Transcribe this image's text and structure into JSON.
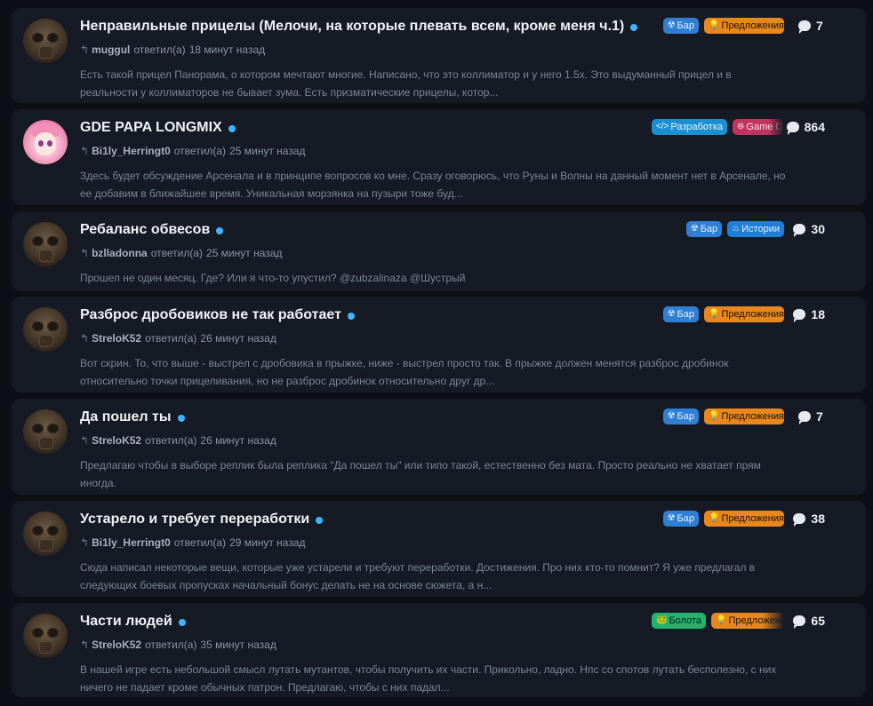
{
  "topics": [
    {
      "avatar": "gasmask-avatar",
      "title": "Неправильные прицелы (Мелочи, на которые плевать всем, кроме меня ч.1)",
      "user": "muggul",
      "answered": "ответил(а)",
      "time": "18 минут назад",
      "excerpt": "Есть такой прицел Панорама, о котором мечтают многие. Написано, что это коллиматор и у него 1.5x. Это выдуманный прицел и в реальности у коллиматоров не бывает зума. Есть призматические прицелы, котор...",
      "tags": [
        {
          "label": "Бар",
          "icon": "radiation-icon",
          "glyph": "☢",
          "style": "bar"
        },
        {
          "label": "Предложения",
          "icon": "lightbulb-icon",
          "glyph": "💡",
          "style": "pred"
        }
      ],
      "replies": "7"
    },
    {
      "avatar": "anime-avatar",
      "title": "GDE PAPA LONGMIX",
      "user": "Bi1ly_Herringt0",
      "answered": "ответил(а)",
      "time": "25 минут назад",
      "excerpt": "Здесь будет обсуждение Арсенала и в принципе вопросов ко мне. Сразу оговорюсь, что Руны и Волны на данный момент нет в Арсенале, но ее добавим в ближайшее время. Уникальная морзянка на пузыри тоже буд...",
      "tags": [
        {
          "label": "Разработка",
          "icon": "code-icon",
          "glyph": "</>",
          "style": "dev"
        },
        {
          "label": "Game D",
          "icon": "gamepad-icon",
          "glyph": "⊛",
          "style": "gd fade"
        }
      ],
      "replies": "864"
    },
    {
      "avatar": "gasmask-avatar",
      "title": "Ребаланс обвесов",
      "user": "bzlladonna",
      "answered": "ответил(а)",
      "time": "25 минут назад",
      "excerpt": "Прошел не один месяц. Где? Или я что-то упустил? @zubzalinaza @Шустрый",
      "tags": [
        {
          "label": "Бар",
          "icon": "radiation-icon",
          "glyph": "☢",
          "style": "bar"
        },
        {
          "label": "Истории",
          "icon": "flame-icon",
          "glyph": "♨",
          "style": "hist"
        }
      ],
      "replies": "30"
    },
    {
      "avatar": "gasmask-avatar",
      "title": "Разброс дробовиков не так работает",
      "user": "StreloK52",
      "answered": "ответил(а)",
      "time": "26 минут назад",
      "excerpt": "Вот скрин. То, что выше - выстрел с дробовика в прыжке, ниже - выстрел просто так. В прыжке должен менятся разброс дробинок относительно точки прицеливания, но не разброс дробинок относительно друг др...",
      "tags": [
        {
          "label": "Бар",
          "icon": "radiation-icon",
          "glyph": "☢",
          "style": "bar"
        },
        {
          "label": "Предложения",
          "icon": "lightbulb-icon",
          "glyph": "💡",
          "style": "pred"
        }
      ],
      "replies": "18"
    },
    {
      "avatar": "gasmask-avatar",
      "title": "Да пошел ты",
      "user": "StreloK52",
      "answered": "ответил(а)",
      "time": "26 минут назад",
      "excerpt": "Предлагаю чтобы в выборе реплик была реплика \"Да пошел ты\" или типо такой, естественно без мата. Просто реально не хватает прям иногда.",
      "tags": [
        {
          "label": "Бар",
          "icon": "radiation-icon",
          "glyph": "☢",
          "style": "bar"
        },
        {
          "label": "Предложения",
          "icon": "lightbulb-icon",
          "glyph": "💡",
          "style": "pred"
        }
      ],
      "replies": "7"
    },
    {
      "avatar": "gasmask-avatar",
      "title": "Устарело и требует переработки",
      "user": "Bi1ly_Herringt0",
      "answered": "ответил(а)",
      "time": "29 минут назад",
      "excerpt": "Сюда написал некоторые вещи, которые уже устарели и требуют переработки. Достижения. Про них кто-то помнит? Я уже предлагал в следующих боевых пропусках начальный бонус делать не на основе сюжета, а н...",
      "tags": [
        {
          "label": "Бар",
          "icon": "radiation-icon",
          "glyph": "☢",
          "style": "bar"
        },
        {
          "label": "Предложения",
          "icon": "lightbulb-icon",
          "glyph": "💡",
          "style": "pred"
        }
      ],
      "replies": "38"
    },
    {
      "avatar": "gasmask-avatar",
      "title": "Части людей",
      "user": "StreloK52",
      "answered": "ответил(а)",
      "time": "35 минут назад",
      "excerpt": "В нашей игре есть небольшой смысл лутать мутантов, чтобы получить их части. Прикольно, ладно. Нпс со спотов лутать бесполезно, с них ничего не падает кроме обычных патрон. Предлагаю, чтобы с них падал...",
      "tags": [
        {
          "label": "Болота",
          "icon": "frog-icon",
          "glyph": "🐸",
          "style": "bol"
        },
        {
          "label": "Предложения",
          "icon": "lightbulb-icon",
          "glyph": "💡",
          "style": "pred pred2 fade"
        }
      ],
      "replies": "65"
    }
  ],
  "colors": {
    "background": "#0c0f15",
    "card": "#151a24",
    "unread_dot": "#3eb5ff",
    "tag_bar": "#2f7fd4",
    "tag_suggestions": "#e8871e",
    "tag_dev": "#1c8fd0",
    "tag_gamedesign": "#c2335e",
    "tag_history": "#1f7fd8",
    "tag_swamps": "#23b36e"
  }
}
